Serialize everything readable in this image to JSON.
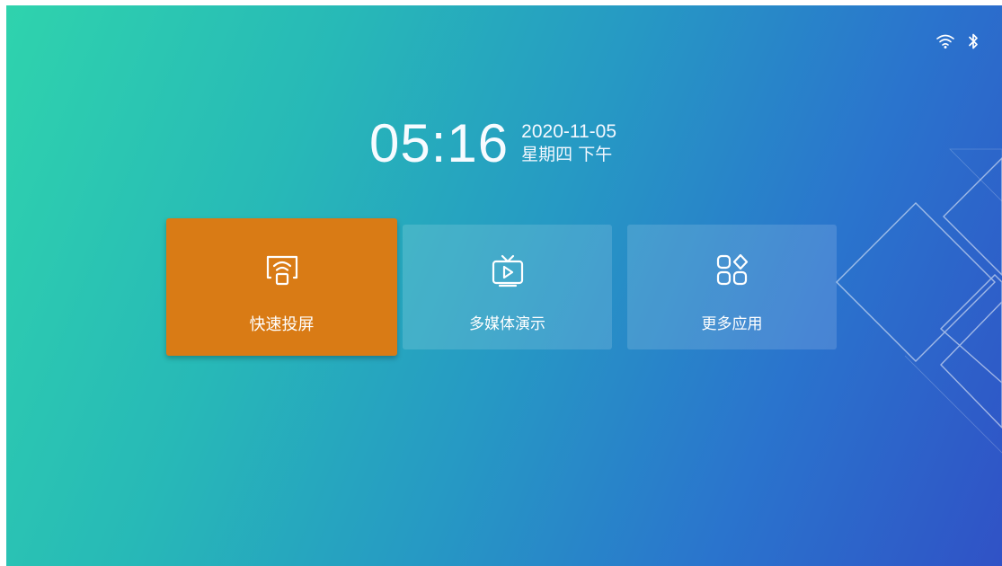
{
  "status_bar": {
    "wifi_icon": "wifi-icon",
    "bluetooth_icon": "bluetooth-icon"
  },
  "clock": {
    "time": "05:16",
    "date": "2020-11-05",
    "weekday": "星期四 下午"
  },
  "tiles": [
    {
      "label": "快速投屏",
      "icon": "screen-cast-icon",
      "color": "#d97b15",
      "selected": true
    },
    {
      "label": "多媒体演示",
      "icon": "tv-play-icon",
      "selected": false
    },
    {
      "label": "更多应用",
      "icon": "apps-grid-icon",
      "selected": false
    }
  ],
  "theme": {
    "background_from": "#2fd3ad",
    "background_to": "#3052c6",
    "accent": "#d97b15"
  }
}
